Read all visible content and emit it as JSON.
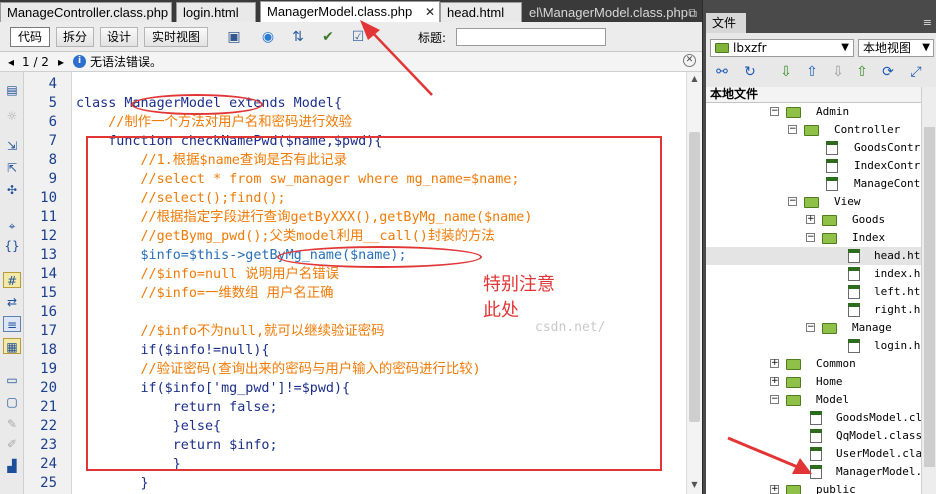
{
  "tabs": [
    {
      "label": "ManageController.class.php"
    },
    {
      "label": "login.html"
    },
    {
      "label": "ManagerModel.class.php",
      "active": true
    },
    {
      "label": "head.html"
    },
    {
      "label": "el\\ManagerModel.class.php"
    }
  ],
  "toolbar": {
    "code_label": "代码",
    "split_label": "拆分",
    "design_label": "设计",
    "live_label": "实时视图",
    "title_label": "标题:",
    "title_value": ""
  },
  "infobar": {
    "page": "1 / 2",
    "message": "无语法错误。"
  },
  "code": {
    "line_numbers": [
      "4",
      "5",
      "6",
      "7",
      "8",
      "9",
      "10",
      "11",
      "12",
      "13",
      "14",
      "15",
      "16",
      "17",
      "18",
      "19",
      "20",
      "21",
      "22",
      "23",
      "24",
      "25"
    ],
    "lines": [
      "",
      "class ManagerModel extends Model{",
      "    //制作一个方法对用户名和密码进行效验",
      "    function checkNamePwd($name,$pwd){",
      "        //1.根据$name查询是否有此记录",
      "        //select * from sw_manager where mg_name=$name;",
      "        //select();find();",
      "        //根据指定字段进行查询getByXXX(),getByMg_name($name)",
      "        //getBymg_pwd();父类model利用__call()封装的方法",
      "        $info=$this->getByMg_name($name);",
      "        //$info=null 说明用户名错误",
      "        //$info=一维数组 用户名正确",
      "",
      "        //$info不为null,就可以继续验证密码",
      "        if($info!=null){",
      "        //验证密码(查询出来的密码与用户输入的密码进行比较)",
      "        if($info['mg_pwd']!=$pwd){",
      "            return false;",
      "            }else{",
      "            return $info;",
      "            }",
      "        }"
    ]
  },
  "annotation": {
    "note_line1": "特别注意",
    "note_line2": "此处",
    "watermark": "csdn.net/"
  },
  "files_panel": {
    "tab_label": "文件",
    "site": "lbxzfr",
    "view": "本地视图",
    "header": "本地文件",
    "tree": [
      {
        "label": "Admin",
        "type": "folder",
        "expanded": true
      },
      {
        "label": "Controller",
        "type": "folder",
        "expanded": true
      },
      {
        "label": "GoodsContr",
        "type": "file"
      },
      {
        "label": "IndexContr",
        "type": "file"
      },
      {
        "label": "ManageCont",
        "type": "file"
      },
      {
        "label": "View",
        "type": "folder",
        "expanded": true
      },
      {
        "label": "Goods",
        "type": "folder",
        "expanded": false
      },
      {
        "label": "Index",
        "type": "folder",
        "expanded": true
      },
      {
        "label": "head.ht",
        "type": "file"
      },
      {
        "label": "index.h",
        "type": "file"
      },
      {
        "label": "left.ht",
        "type": "file"
      },
      {
        "label": "right.h",
        "type": "file"
      },
      {
        "label": "Manage",
        "type": "folder",
        "expanded": true
      },
      {
        "label": "login.h",
        "type": "file"
      },
      {
        "label": "Common",
        "type": "folder",
        "expanded": false
      },
      {
        "label": "Home",
        "type": "folder",
        "expanded": false
      },
      {
        "label": "Model",
        "type": "folder",
        "expanded": true
      },
      {
        "label": "GoodsModel.cla",
        "type": "file"
      },
      {
        "label": "QqModel.class.",
        "type": "file"
      },
      {
        "label": "UserModel.clas",
        "type": "file"
      },
      {
        "label": "ManagerModel.c",
        "type": "file"
      },
      {
        "label": "public",
        "type": "folder",
        "expanded": false
      }
    ]
  },
  "colors": {
    "annotation": "#e23636",
    "comment": "#f07b07",
    "keyword": "#1b2f8a",
    "variable": "#2770b8",
    "string": "#c20d0d"
  }
}
